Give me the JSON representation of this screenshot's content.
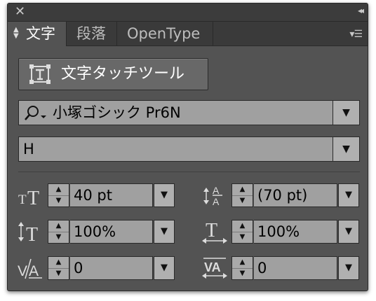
{
  "window": {
    "close_glyph": "✕",
    "collapse_glyph": "◂◂",
    "menu_glyph": "▾☰"
  },
  "tabs": [
    {
      "label": "文字",
      "active": true
    },
    {
      "label": "段落",
      "active": false
    },
    {
      "label": "OpenType",
      "active": false
    }
  ],
  "touch_button": {
    "label": "文字タッチツール",
    "icon": "touch-type-tool-icon"
  },
  "font_family": {
    "value": "小塚ゴシック Pr6N",
    "icon": "font-search-icon"
  },
  "font_style": {
    "value": "H"
  },
  "fields": {
    "font_size": {
      "value": "40 pt",
      "icon": "font-size-icon"
    },
    "leading": {
      "value": "(70 pt)",
      "icon": "leading-icon"
    },
    "vertical_scale": {
      "value": "100%",
      "icon": "vertical-scale-icon"
    },
    "horizontal_scale": {
      "value": "100%",
      "icon": "horizontal-scale-icon"
    },
    "kerning": {
      "value": "0",
      "icon": "kerning-icon"
    },
    "tracking": {
      "value": "0",
      "icon": "tracking-icon"
    }
  },
  "colors": {
    "panel_bg": "#535353",
    "tab_bar_bg": "#3a3a3a",
    "field_bg": "#a0a0a0"
  }
}
